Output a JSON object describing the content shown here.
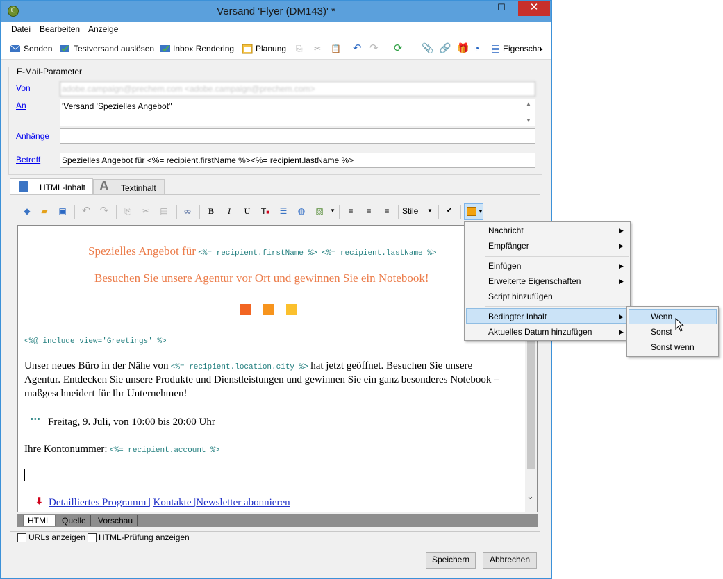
{
  "window": {
    "title": "Versand 'Flyer (DM143)' *"
  },
  "menubar": {
    "items": [
      "Datei",
      "Bearbeiten",
      "Anzeige"
    ]
  },
  "toolbar": {
    "send": "Senden",
    "test_send": "Testversand auslösen",
    "inbox_rendering": "Inbox Rendering",
    "planning": "Planung",
    "properties": "Eigenscha"
  },
  "email_params": {
    "legend": "E-Mail-Parameter",
    "from_label": "Von",
    "from_value": "adobe.campaign@prechem.com <adobe.campaign@prechem.com>",
    "to_label": "An",
    "to_value": "'Versand 'Spezielles Angebot''",
    "attachments_label": "Anhänge",
    "attachments_value": "",
    "subject_label": "Betreff",
    "subject_value": "Spezielles Angebot für <%= recipient.firstName %><%= recipient.lastName %>"
  },
  "tabs": {
    "html": "HTML-Inhalt",
    "text": "Textinhalt"
  },
  "format_bar": {
    "styles": "Stile"
  },
  "editor": {
    "headline_prefix": "Spezielles Angebot für",
    "headline_code": "<%= recipient.firstName %> <%= recipient.lastName %>",
    "subheadline": "Besuchen Sie unsere Agentur vor Ort und gewinnen Sie ein Notebook!",
    "squares_colors": [
      "#f26522",
      "#f7941d",
      "#fbc02d"
    ],
    "include": "<%@ include view='Greetings' %>",
    "para_part1": "Unser neues Büro in der Nähe von",
    "para_code": "<%= recipient.location.city %>",
    "para_part2": "hat jetzt geöffnet. Besuchen Sie unsere",
    "para_line2": "Agentur. Entdecken Sie unsere Produkte und Dienstleistungen und gewinnen Sie ein ganz besonderes Notebook –",
    "para_line3": "maßgeschneidert für Ihr Unternehmen!",
    "bullet_marker": "•••",
    "date_line": "Freitag, 9. Juli, von 10:00 bis 20:00 Uhr",
    "account_label": "Ihre Kontonummer:",
    "account_code": "<%= recipient.account %>",
    "link_program": "Detailliertes Programm ",
    "link_contacts": "Kontakte ",
    "link_newsletter": "Newsletter abonnieren",
    "link_sep": "|"
  },
  "bottom_tabs": [
    "HTML",
    "Quelle",
    "Vorschau"
  ],
  "options": {
    "show_urls": "URLs anzeigen",
    "html_check": "HTML-Prüfung anzeigen"
  },
  "buttons": {
    "save": "Speichern",
    "cancel": "Abbrechen"
  },
  "context_menu": {
    "items": [
      "Nachricht",
      "Empfänger",
      "Einfügen",
      "Erweiterte Eigenschaften",
      "Script hinzufügen",
      "Bedingter Inhalt",
      "Aktuelles Datum hinzufügen"
    ],
    "submenu": [
      "Wenn",
      "Sonst",
      "Sonst wenn"
    ]
  }
}
